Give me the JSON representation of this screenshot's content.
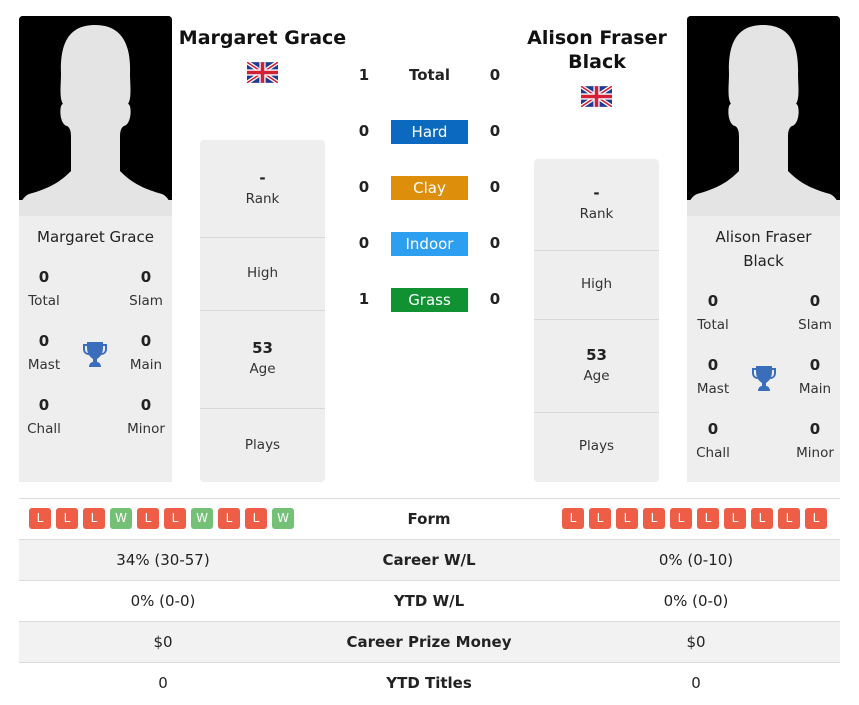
{
  "player1": {
    "name": "Margaret Grace",
    "country_flag": "uk-flag",
    "titles": {
      "total": {
        "value": "0",
        "label": "Total"
      },
      "slam": {
        "value": "0",
        "label": "Slam"
      },
      "mast": {
        "value": "0",
        "label": "Mast"
      },
      "main": {
        "value": "0",
        "label": "Main"
      },
      "chall": {
        "value": "0",
        "label": "Chall"
      },
      "minor": {
        "value": "0",
        "label": "Minor"
      }
    },
    "info": {
      "rank": {
        "value": "-",
        "label": "Rank"
      },
      "high": {
        "value": "",
        "label": "High"
      },
      "age": {
        "value": "53",
        "label": "Age"
      },
      "plays": {
        "value": "",
        "label": "Plays"
      }
    },
    "form": [
      "L",
      "L",
      "L",
      "W",
      "L",
      "L",
      "W",
      "L",
      "L",
      "W"
    ],
    "career_wl": "34% (30-57)",
    "ytd_wl": "0% (0-0)",
    "career_prize": "$0",
    "ytd_titles": "0"
  },
  "player2": {
    "name": "Alison Fraser Black",
    "name_line1": "Alison Fraser",
    "name_line2": "Black",
    "country_flag": "uk-flag",
    "titles": {
      "total": {
        "value": "0",
        "label": "Total"
      },
      "slam": {
        "value": "0",
        "label": "Slam"
      },
      "mast": {
        "value": "0",
        "label": "Mast"
      },
      "main": {
        "value": "0",
        "label": "Main"
      },
      "chall": {
        "value": "0",
        "label": "Chall"
      },
      "minor": {
        "value": "0",
        "label": "Minor"
      }
    },
    "info": {
      "rank": {
        "value": "-",
        "label": "Rank"
      },
      "high": {
        "value": "",
        "label": "High"
      },
      "age": {
        "value": "53",
        "label": "Age"
      },
      "plays": {
        "value": "",
        "label": "Plays"
      }
    },
    "form": [
      "L",
      "L",
      "L",
      "L",
      "L",
      "L",
      "L",
      "L",
      "L",
      "L"
    ],
    "career_wl": "0% (0-10)",
    "ytd_wl": "0% (0-0)",
    "career_prize": "$0",
    "ytd_titles": "0"
  },
  "h2h": [
    {
      "surface": "Total",
      "p1": "1",
      "p2": "0",
      "color": ""
    },
    {
      "surface": "Hard",
      "p1": "0",
      "p2": "0",
      "color": "#0b6abf"
    },
    {
      "surface": "Clay",
      "p1": "0",
      "p2": "0",
      "color": "#dd8f0b"
    },
    {
      "surface": "Indoor",
      "p1": "0",
      "p2": "0",
      "color": "#2d9ff0"
    },
    {
      "surface": "Grass",
      "p1": "1",
      "p2": "0",
      "color": "#109232"
    }
  ],
  "comparison": {
    "form_label": "Form",
    "career_wl_label": "Career W/L",
    "ytd_wl_label": "YTD W/L",
    "career_prize_label": "Career Prize Money",
    "ytd_titles_label": "YTD Titles"
  }
}
